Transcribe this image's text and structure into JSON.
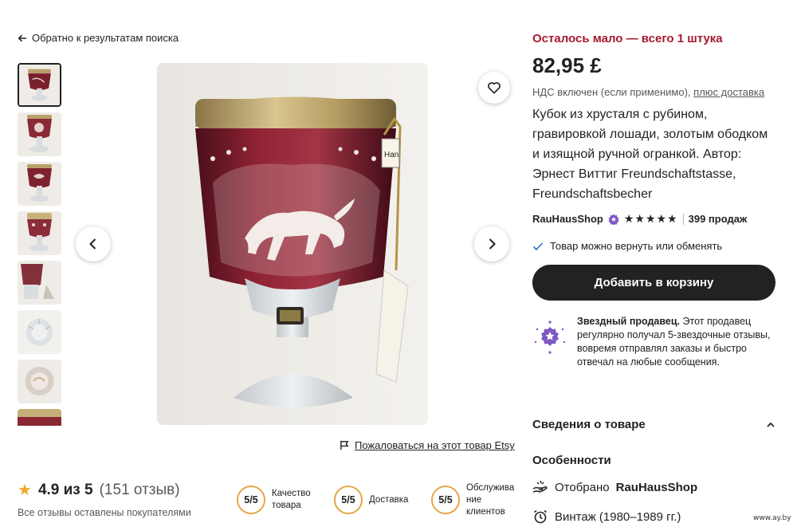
{
  "nav": {
    "back_label": "Обратно к результатам поиска"
  },
  "gallery": {
    "thumbnail_count": 8,
    "active_index": 0,
    "label_tag": "Han"
  },
  "report": {
    "label": "Пожаловаться на этот товар Etsy"
  },
  "reviews": {
    "score": "4.9 из 5",
    "count": "(151 отзыв)",
    "note": "Все отзывы оставлены покупателями",
    "metrics": [
      {
        "value": "5/5",
        "label": "Качество товара"
      },
      {
        "value": "5/5",
        "label": "Доставка"
      },
      {
        "value": "5/5",
        "label": "Обслужива ние клиентов"
      }
    ]
  },
  "product": {
    "stock_notice": "Осталось мало — всего 1 штука",
    "price": "82,95 £",
    "vat_text": "НДС включен (если применимо),",
    "vat_link": "плюс доставка",
    "title": "Кубок из хрусталя с рубином, гравировкой лошади, золотым ободком и изящной ручной огранкой. Автор: Эрнест Виттиг Freundschaftstasse, Freundschaftsbecher",
    "shop_name": "RauHausShop",
    "shop_rating": 5,
    "sales": "399 продаж",
    "returns": "Товар можно вернуть или обменять",
    "cart_button": "Добавить в корзину",
    "star_seller_title": "Звездный продавец.",
    "star_seller_text": "Этот продавец регулярно получал 5-звездочные отзывы, вовремя отправлял заказы и быстро отвечал на любые сообщения."
  },
  "details": {
    "heading": "Сведения о товаре",
    "features_heading": "Особенности",
    "curated_prefix": "Отобрано",
    "curated_shop": "RauHausShop",
    "vintage": "Винтаж (1980–1989 гг.)"
  },
  "watermark": "www.ay.by",
  "colors": {
    "stock": "#a61a2e",
    "metric_ring": "#e8a547",
    "badge": "#7f56c5",
    "cart": "#222222"
  },
  "icons": [
    "arrow-left-icon",
    "chevron-left-icon",
    "chevron-right-icon",
    "heart-icon",
    "flag-icon",
    "star-icon",
    "star-seller-badge-icon",
    "check-icon",
    "chevron-up-icon",
    "hand-icon",
    "alarm-clock-icon"
  ]
}
